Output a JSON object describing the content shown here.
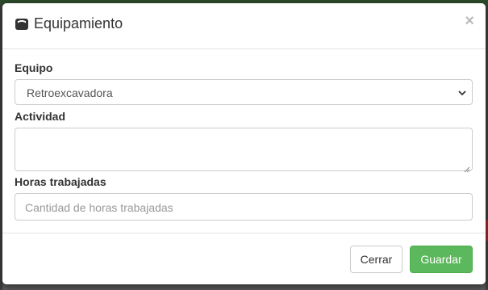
{
  "modal": {
    "title": "Equipamiento",
    "title_icon": "cooking-pot-icon",
    "close_label": "×"
  },
  "form": {
    "equipo": {
      "label": "Equipo",
      "selected": "Retroexcavadora"
    },
    "actividad": {
      "label": "Actividad",
      "value": ""
    },
    "horas": {
      "label": "Horas trabajadas",
      "placeholder": "Cantidad de horas trabajadas",
      "value": ""
    }
  },
  "footer": {
    "cerrar_label": "Cerrar",
    "guardar_label": "Guardar"
  },
  "colors": {
    "primary_button": "#5cb85c",
    "backdrop": "#5a5a5a"
  }
}
